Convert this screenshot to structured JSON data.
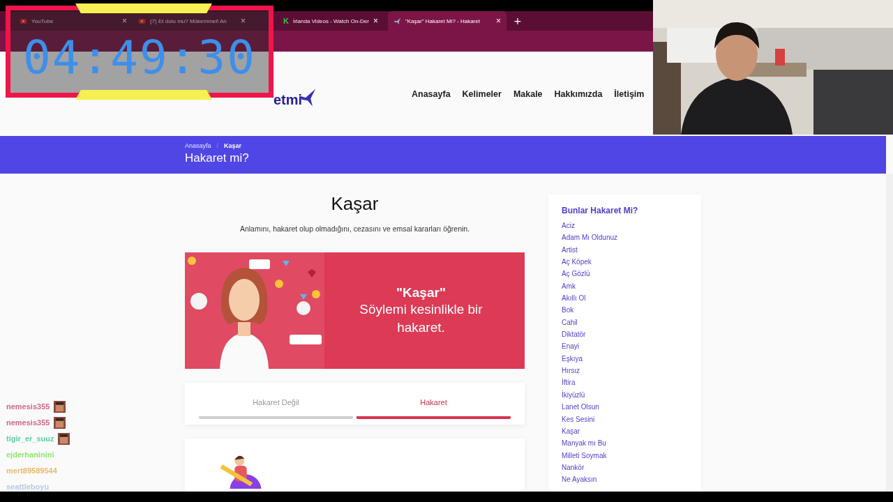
{
  "browser": {
    "tabs": [
      {
        "title": "YouTube",
        "kind": "video",
        "close": "×",
        "selected": false
      },
      {
        "title": "(7) Et dolu mu? Mükemmel! An",
        "kind": "video",
        "close": "×",
        "selected": false
      },
      {
        "title": "İrlanda Videos - Watch On-Der",
        "kind": "letter",
        "icon_text": "K",
        "close": "×",
        "selected": false
      },
      {
        "title": "\"Kaşar\" Hakaret Mi? - Hakaret",
        "kind": "bird",
        "close": "×",
        "selected": true
      }
    ],
    "new_tab": "+"
  },
  "timer": {
    "time": "04:49:30"
  },
  "site": {
    "logo": "etmi",
    "nav": [
      "Anasayfa",
      "Kelimeler",
      "Makale",
      "Hakkımızda",
      "İletişim"
    ]
  },
  "hero": {
    "breadcrumb": [
      {
        "label": "Anasayfa",
        "current": false
      },
      {
        "label": "Kaşar",
        "current": true
      }
    ],
    "separator": "/",
    "title": "Hakaret mi?"
  },
  "article": {
    "title": "Kaşar",
    "subtitle": "Anlamını, hakaret olup olmadığını, cezasını ve emsal kararları öğrenin.",
    "banner": {
      "quote": "\"Kaşar\"",
      "text": "Söylemi kesinlikle bir hakaret."
    },
    "verdict_tabs": [
      {
        "label": "Hakaret Değil",
        "selected": false
      },
      {
        "label": "Hakaret",
        "selected": true
      }
    ]
  },
  "sidebar": {
    "title": "Bunlar Hakaret Mi?",
    "items": [
      "Aciz",
      "Adam Mı Oldunuz",
      "Artist",
      "Aç Köpek",
      "Aç Gözlü",
      "Amk",
      "Akıllı Ol",
      "Bok",
      "Cahil",
      "Diktatör",
      "Enayi",
      "Eşkıya",
      "Hırsız",
      "İftira",
      "İkiyüzlü",
      "Lanet Olsun",
      "Kes Sesini",
      "Kaşar",
      "Manyak mı Bu",
      "Milleti Soymak",
      "Nankör",
      "Ne Ayaksın"
    ]
  },
  "chat": [
    {
      "user": "nemesis355",
      "color": "#d4688a",
      "emote": true
    },
    {
      "user": "nemesis355",
      "color": "#d4688a",
      "emote": true
    },
    {
      "user": "tigir_er_suuz",
      "color": "#5ccfa2",
      "emote": true
    },
    {
      "user": "ejderhaninini",
      "color": "#8ee66c",
      "emote": false
    },
    {
      "user": "mert89589544",
      "color": "#e9b96c",
      "emote": false
    },
    {
      "user": "seattleboyu",
      "color": "#b7c9e6",
      "emote": false
    }
  ]
}
